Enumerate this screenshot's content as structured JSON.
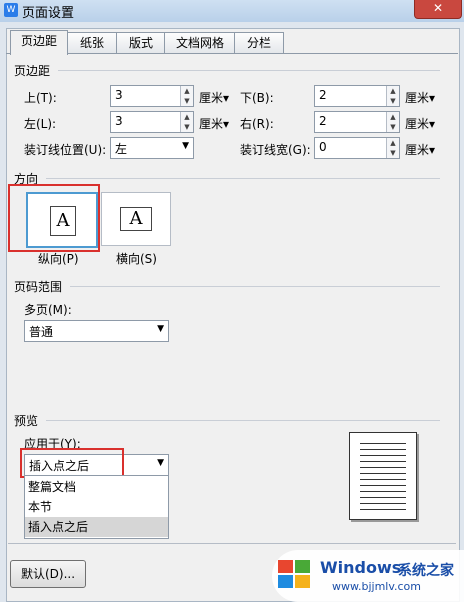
{
  "window": {
    "title": "页面设置",
    "close": "✕"
  },
  "tabs": [
    "页边距",
    "纸张",
    "版式",
    "文档网格",
    "分栏"
  ],
  "margins": {
    "section": "页边距",
    "top_label": "上(T):",
    "top_value": "3",
    "bottom_label": "下(B):",
    "bottom_value": "2",
    "left_label": "左(L):",
    "left_value": "3",
    "right_label": "右(R):",
    "right_value": "2",
    "gutter_pos_label": "装订线位置(U):",
    "gutter_pos_value": "左",
    "gutter_width_label": "装订线宽(G):",
    "gutter_width_value": "0",
    "unit": "厘米▾"
  },
  "orientation": {
    "section": "方向",
    "portrait": "纵向(P)",
    "landscape": "横向(S)",
    "page_glyph": "A"
  },
  "page_range": {
    "section": "页码范围",
    "multi_label": "多页(M):",
    "multi_value": "普通"
  },
  "preview": {
    "section": "预览",
    "apply_label": "应用于(Y):",
    "apply_value": "插入点之后",
    "options": [
      "整篇文档",
      "本节",
      "插入点之后"
    ],
    "selected_option": "插入点之后"
  },
  "footer": {
    "default_button": "默认(D)..."
  },
  "watermark": {
    "title": "Windows",
    "cn": "系统之家",
    "url": "www.bjjmlv.com"
  },
  "colors": {
    "highlight_red": "#d9302d",
    "selected_blue": "#4d9ad1",
    "titlebar": "#b9d0e9"
  }
}
